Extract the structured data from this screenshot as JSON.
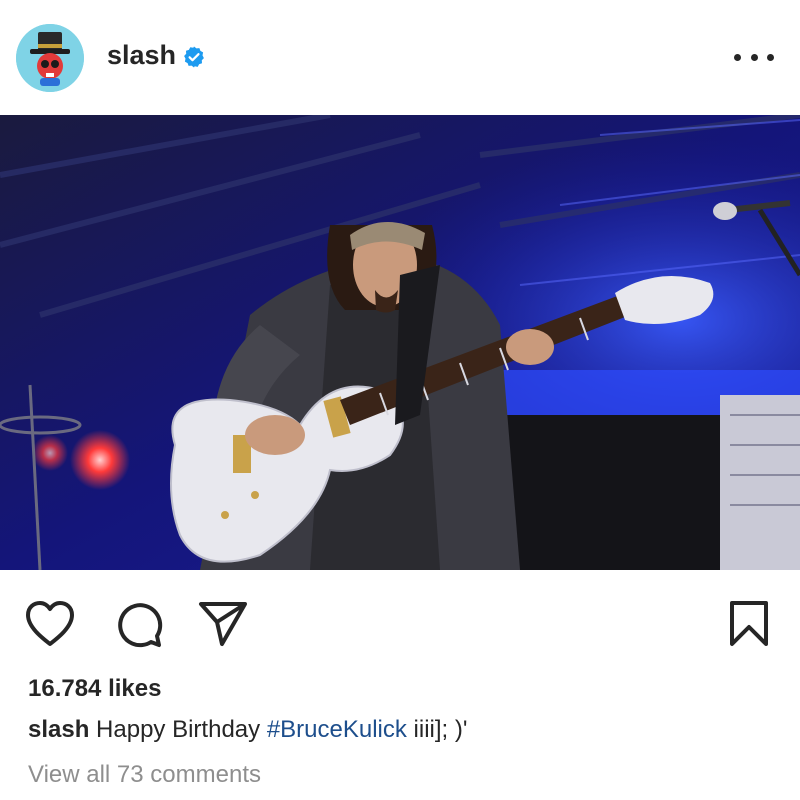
{
  "post": {
    "username": "slash",
    "verified": true,
    "likes_text": "16.784 likes",
    "caption": {
      "username": "slash",
      "text_before": "Happy Birthday",
      "hashtag": "#BruceKulick",
      "text_after": "iiii]; )'"
    },
    "comments_link": "View all 73 comments"
  },
  "icons": {
    "verified": "verified-badge-icon",
    "more": "more-options-icon",
    "like": "heart-icon",
    "comment": "comment-bubble-icon",
    "share": "paper-plane-icon",
    "save": "bookmark-icon"
  },
  "colors": {
    "verified_blue": "#1d9bf0",
    "hashtag": "#1d4e8c",
    "muted_text": "#8e8e8e",
    "text": "#262626",
    "avatar_bg": "#7fd3e6"
  }
}
